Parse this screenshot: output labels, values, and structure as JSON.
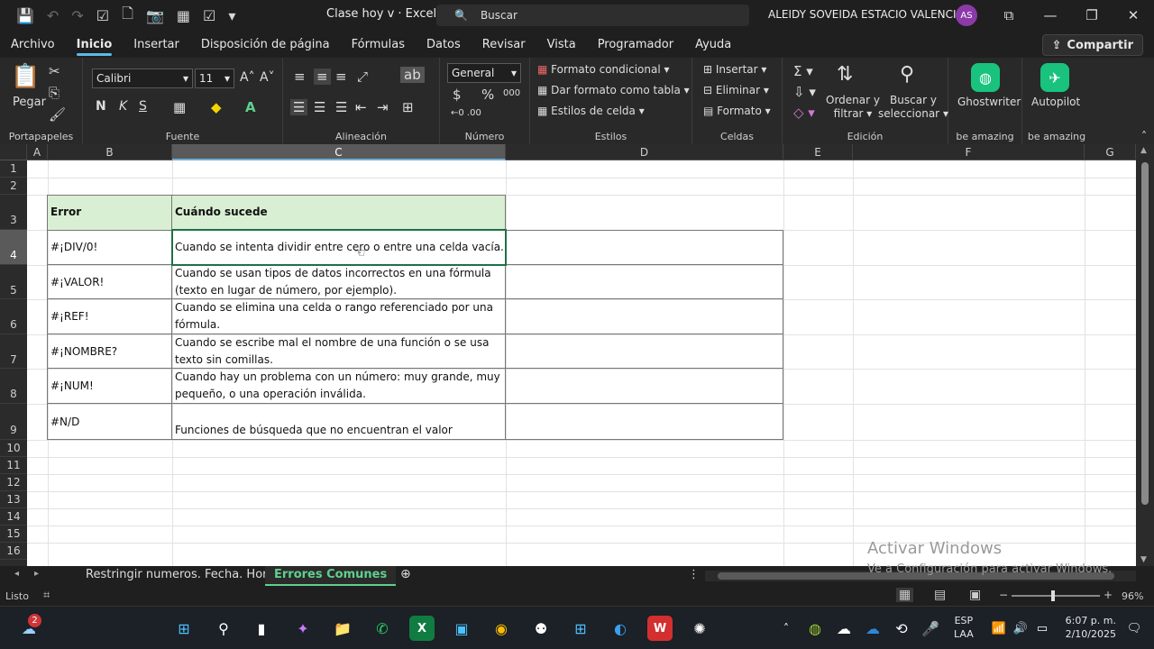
{
  "window": {
    "doc_title": "Clase hoy v  ·  Excel",
    "search_placeholder": "Buscar",
    "user_name": "ALEIDY SOVEIDA ESTACIO VALENCIA",
    "user_initials": "AS"
  },
  "menu": {
    "tabs": [
      "Archivo",
      "Inicio",
      "Insertar",
      "Disposición de página",
      "Fórmulas",
      "Datos",
      "Revisar",
      "Vista",
      "Programador",
      "Ayuda"
    ],
    "share_label": "Compartir"
  },
  "ribbon": {
    "clipboard": {
      "paste_label": "Pegar",
      "group_label": "Portapapeles"
    },
    "font": {
      "font_name": "Calibri",
      "font_size": "11",
      "bold": "N",
      "italic": "K",
      "underline": "S",
      "group_label": "Fuente"
    },
    "alignment": {
      "group_label": "Alineación"
    },
    "number": {
      "format": "General",
      "group_label": "Número"
    },
    "styles": {
      "conditional": "Formato condicional",
      "as_table": "Dar formato como tabla",
      "cell_styles": "Estilos de celda",
      "group_label": "Estilos"
    },
    "cells": {
      "insert": "Insertar",
      "delete": "Eliminar",
      "format": "Formato",
      "group_label": "Celdas"
    },
    "editing": {
      "sort": "Ordenar y",
      "sort2": "filtrar",
      "find": "Buscar y",
      "find2": "seleccionar",
      "group_label": "Edición"
    },
    "addins": [
      {
        "name": "Ghostwriter",
        "group": "be amazing"
      },
      {
        "name": "Autopilot",
        "group": "be amazing"
      }
    ]
  },
  "columns": [
    "A",
    "B",
    "C",
    "D",
    "E",
    "F",
    "G"
  ],
  "rows": [
    "1",
    "2",
    "3",
    "4",
    "5",
    "6",
    "7",
    "8",
    "9",
    "10",
    "11",
    "12",
    "13",
    "14",
    "15",
    "16"
  ],
  "table": {
    "header": {
      "error": "Error",
      "when": "Cuándo sucede"
    },
    "rows": [
      {
        "error": "#¡DIV/0!",
        "when": "Cuando se intenta dividir entre cero o entre una celda vacía."
      },
      {
        "error": "#¡VALOR!",
        "when": "Cuando se usan tipos de datos incorrectos en una fórmula (texto en lugar de número, por ejemplo)."
      },
      {
        "error": "#¡REF!",
        "when": "Cuando se elimina una celda o rango referenciado por una fórmula."
      },
      {
        "error": "#¡NOMBRE?",
        "when": "Cuando se escribe mal el nombre de una función o se usa texto sin comillas."
      },
      {
        "error": "#¡NUM!",
        "when": "Cuando hay un problema con un número: muy grande, muy pequeño, o una operación inválida."
      },
      {
        "error": "#N/D",
        "when": "Funciones de búsqueda que no encuentran el valor"
      }
    ]
  },
  "watermark": {
    "title": "Activar Windows",
    "subtitle": "Ve a Configuración para activar Windows."
  },
  "sheets": [
    "Restringir numeros. Fecha. Hora",
    "Errores Comunes"
  ],
  "status": {
    "ready": "Listo",
    "zoom": "96%"
  },
  "taskbar": {
    "lang1": "ESP",
    "lang2": "LAA",
    "time": "6:07 p. m.",
    "date": "2/10/2025",
    "weather_badge": "2"
  }
}
